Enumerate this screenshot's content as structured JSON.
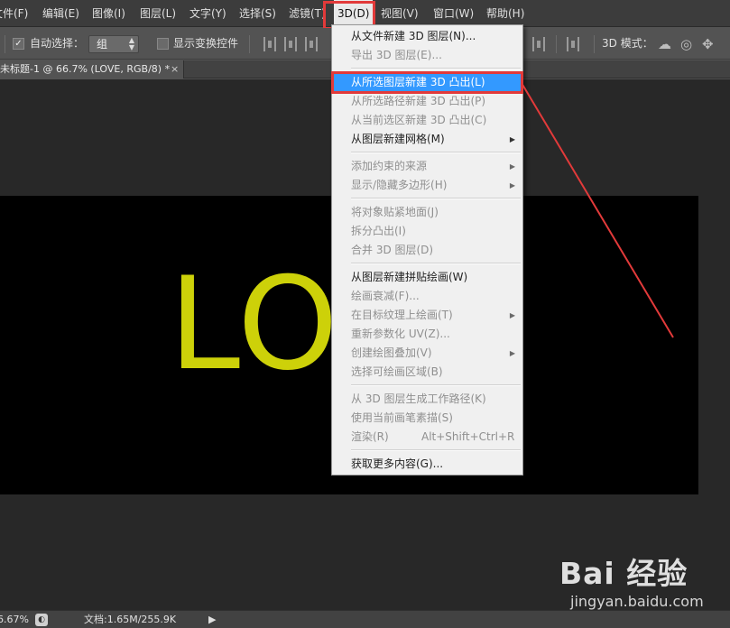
{
  "menubar": {
    "items": [
      "文件(F)",
      "编辑(E)",
      "图像(I)",
      "图层(L)",
      "文字(Y)",
      "选择(S)",
      "滤镜(T)",
      "3D(D)",
      "视图(V)",
      "窗口(W)",
      "帮助(H)"
    ],
    "active": "3D(D)"
  },
  "options": {
    "auto_select_label": "自动选择：",
    "auto_select_checked": true,
    "group_value": "组",
    "show_transform_label": "显示变换控件",
    "mode_3d_label": "3D 模式："
  },
  "document": {
    "tab_title": "未标题-1 @ 66.7% (LOVE, RGB/8) *",
    "close_glyph": "×",
    "canvas_text": "LOV"
  },
  "dropdown": {
    "items": [
      {
        "label": "从文件新建 3D 图层(N)...",
        "enabled": true
      },
      {
        "label": "导出 3D 图层(E)...",
        "enabled": false
      },
      {
        "label": "从所选图层新建 3D 凸出(L)",
        "enabled": true,
        "highlighted": true
      },
      {
        "label": "从所选路径新建 3D 凸出(P)",
        "enabled": false
      },
      {
        "label": "从当前选区新建 3D 凸出(C)",
        "enabled": false
      },
      {
        "label": "从图层新建网格(M)",
        "enabled": true,
        "submenu": true
      },
      {
        "label": "添加约束的来源",
        "enabled": false,
        "submenu": true
      },
      {
        "label": "显示/隐藏多边形(H)",
        "enabled": false,
        "submenu": true
      },
      {
        "label": "将对象贴紧地面(J)",
        "enabled": false
      },
      {
        "label": "拆分凸出(I)",
        "enabled": false
      },
      {
        "label": "合并 3D 图层(D)",
        "enabled": false
      },
      {
        "label": "从图层新建拼贴绘画(W)",
        "enabled": true
      },
      {
        "label": "绘画衰减(F)...",
        "enabled": false
      },
      {
        "label": "在目标纹理上绘画(T)",
        "enabled": false,
        "submenu": true
      },
      {
        "label": "重新参数化 UV(Z)...",
        "enabled": false
      },
      {
        "label": "创建绘图叠加(V)",
        "enabled": false,
        "submenu": true
      },
      {
        "label": "选择可绘画区域(B)",
        "enabled": false
      },
      {
        "label": "从 3D 图层生成工作路径(K)",
        "enabled": false
      },
      {
        "label": "使用当前画笔素描(S)",
        "enabled": false
      },
      {
        "label": "渲染(R)",
        "enabled": false,
        "shortcut": "Alt+Shift+Ctrl+R"
      },
      {
        "label": "获取更多内容(G)...",
        "enabled": true
      }
    ]
  },
  "statusbar": {
    "zoom": "6.67%",
    "doc_info": "文档:1.65M/255.9K",
    "arrow": "▶"
  },
  "watermark": {
    "logo": "Bai 经验",
    "url": "jingyan.baidu.com"
  },
  "colors": {
    "menubar_bg": "#3c3c3c",
    "highlight": "#3399ff",
    "annotation_red": "#e23a3a",
    "text_yellow": "#cdd109"
  }
}
